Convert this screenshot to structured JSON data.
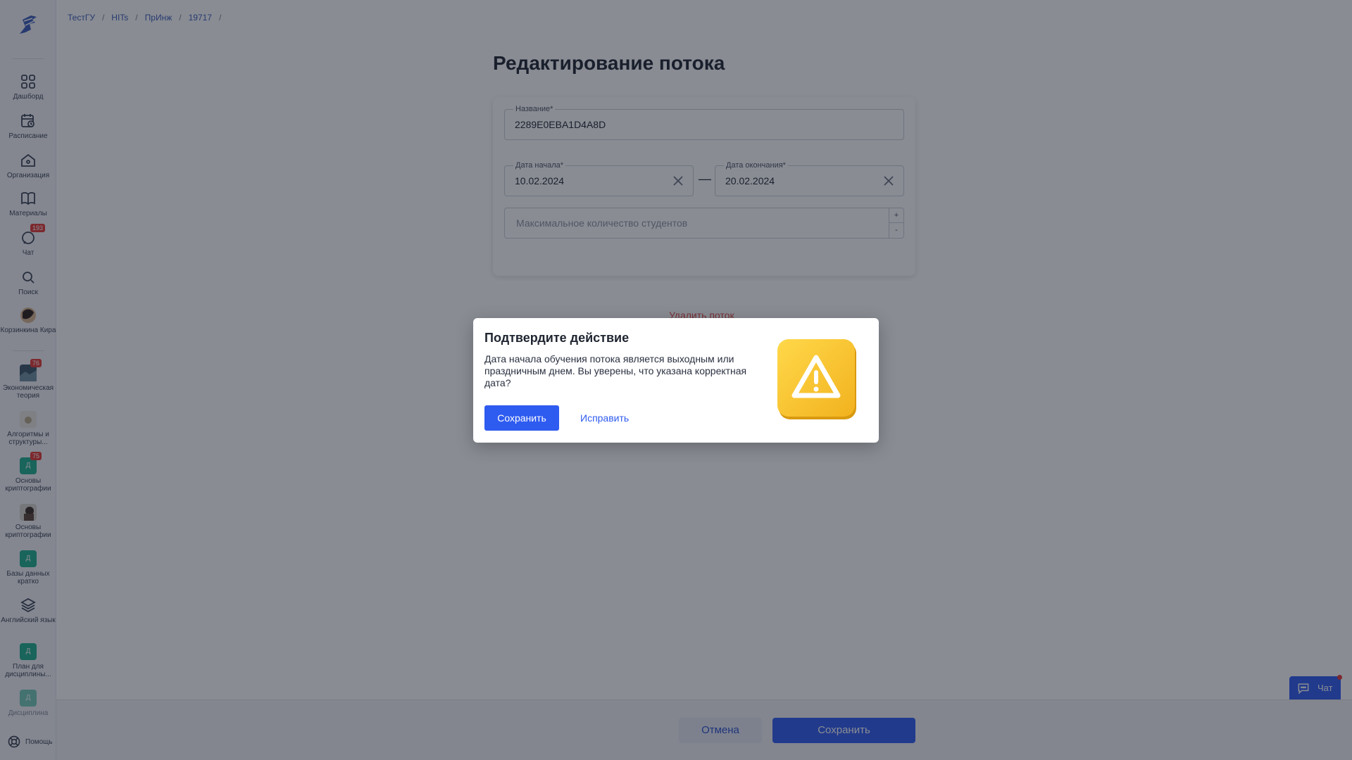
{
  "breadcrumb": [
    "ТестГУ",
    "HITs",
    "ПрИнж",
    "19717"
  ],
  "breadcrumb_sep": "/",
  "sidebar": {
    "items": [
      {
        "label": "Дашборд"
      },
      {
        "label": "Расписание"
      },
      {
        "label": "Организация"
      },
      {
        "label": "Материалы"
      },
      {
        "label": "Чат",
        "badge": "193"
      },
      {
        "label": "Поиск"
      },
      {
        "label": "Корзинкина Кира"
      }
    ],
    "courses": [
      {
        "label": "Экономическая теория",
        "badge": "76"
      },
      {
        "label": "Алгоритмы и структуры..."
      },
      {
        "label": "Основы криптографии",
        "badge": "75",
        "tile": "Д"
      },
      {
        "label": "Основы криптографии"
      },
      {
        "label": "Базы данных кратко",
        "tile": "Д"
      },
      {
        "label": "Английский язык"
      },
      {
        "label": "План для дисциплины...",
        "tile": "Д"
      },
      {
        "label": "Дисциплина",
        "tile": "Д"
      }
    ],
    "help": "Помощь"
  },
  "page": {
    "title": "Редактирование потока",
    "name_label": "Название*",
    "name_value": "2289E0EBA1D4A8D",
    "start_label": "Дата начала*",
    "start_value": "10.02.2024",
    "end_label": "Дата окончания*",
    "end_value": "20.02.2024",
    "dash": "—",
    "max_students_placeholder": "Максимальное количество студентов",
    "stepper_plus": "+",
    "stepper_minus": "-",
    "delete_link": "Удалить поток"
  },
  "footer": {
    "cancel": "Отмена",
    "save": "Сохранить"
  },
  "chat_widget": {
    "label": "Чат"
  },
  "modal": {
    "title": "Подтвердите действие",
    "text": "Дата начала обучения потока является выходным или праздничным днем. Вы уверены, что указана корректная дата?",
    "save": "Сохранить",
    "fix": "Исправить"
  },
  "colors": {
    "accent": "#2e5bf0",
    "danger": "#e04848",
    "badge": "#e53935",
    "tile": "#1fae8e",
    "warning": "#f6c531"
  }
}
